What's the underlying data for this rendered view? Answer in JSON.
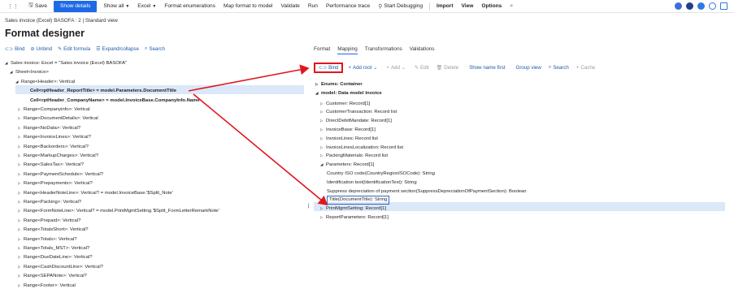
{
  "toolbar": {
    "save": "Save",
    "show_details": "Show details",
    "show_all": "Show all",
    "excel": "Excel",
    "format_enumerations": "Format enumerations",
    "map_format_to_model": "Map format to model",
    "validate": "Validate",
    "run": "Run",
    "performance_trace": "Performance trace",
    "start_debugging": "Start Debugging",
    "import": "Import",
    "view": "View",
    "options": "Options"
  },
  "breadcrumb": "Sales invoice (Excel) BASOFA : 2  |  Standard view",
  "page_title": "Format designer",
  "left_actions": {
    "bind": "Bind",
    "unbind": "Unbind",
    "edit_formula": "Edit formula",
    "expand_collapse": "Expand/collapse",
    "search": "Search"
  },
  "left_tree": [
    {
      "text": "Sales invoice: Excel = \"Sales invoice (Excel) BASOFA\"",
      "twist": "◢",
      "bold": false
    },
    {
      "text": "Sheet<Invoice>",
      "twist": "◢",
      "bold": false
    },
    {
      "text": "Range<Header>: Vertical",
      "twist": "◢",
      "bold": false
    },
    {
      "text": "Cell<rptHeader_ReportTitle> = model.Parameters.DocumentTitle",
      "twist": "",
      "bold": true
    },
    {
      "text": "Cell<rptHeader_CompanyName> = model.InvoiceBase.CompanyInfo.Name",
      "twist": "",
      "bold": true
    },
    {
      "text": "Range<Companyinfo>: Vertical",
      "twist": "▷",
      "bold": false
    },
    {
      "text": "Range<DocumentDetails>: Vertical",
      "twist": "▷",
      "bold": false
    },
    {
      "text": "Range<NoData>: Vertical?",
      "twist": "▷",
      "bold": false
    },
    {
      "text": "Range<InvoiceLines>: Vertical?",
      "twist": "▷",
      "bold": false
    },
    {
      "text": "Range<Backorders>: Vertical?",
      "twist": "▷",
      "bold": false
    },
    {
      "text": "Range<MarkupCharges>: Vertical?",
      "twist": "▷",
      "bold": false
    },
    {
      "text": "Range<SalesTax>: Vertical?",
      "twist": "▷",
      "bold": false
    },
    {
      "text": "Range<PaymentSchedule>: Vertical?",
      "twist": "▷",
      "bold": false
    },
    {
      "text": "Range<Prepayments>: Vertical?",
      "twist": "▷",
      "bold": false
    },
    {
      "text": "Range<HeaderNoteLine>: Vertical? = model.InvoiceBase.'$Split_Note'",
      "twist": "▷",
      "bold": false
    },
    {
      "text": "Range<Packing>: Vertical?",
      "twist": "▷",
      "bold": false
    },
    {
      "text": "Range<FormNoteLine>: Vertical? = model.PrintMgmtSetting.'$Split_FormLetterRemarkNote'",
      "twist": "▷",
      "bold": false
    },
    {
      "text": "Range<Prepaid>: Vertical?",
      "twist": "▷",
      "bold": false
    },
    {
      "text": "Range<TotalsShort>: Vertical?",
      "twist": "▷",
      "bold": false
    },
    {
      "text": "Range<Totals>: Vertical?",
      "twist": "▷",
      "bold": false
    },
    {
      "text": "Range<Totals_MST>: Vertical?",
      "twist": "▷",
      "bold": false
    },
    {
      "text": "Range<DueDateLine>: Vertical?",
      "twist": "▷",
      "bold": false
    },
    {
      "text": "Range<CashDiscountLine>: Vertical?",
      "twist": "▷",
      "bold": false
    },
    {
      "text": "Range<SEPANote>: Vertical?",
      "twist": "▷",
      "bold": false
    },
    {
      "text": "Range<Footer>: Vertical",
      "twist": "▷",
      "bold": false
    }
  ],
  "tabs": [
    "Format",
    "Mapping",
    "Transformations",
    "Validations"
  ],
  "right_actions": {
    "bind": "Bind",
    "add_root": "Add root",
    "add": "Add",
    "edit": "Edit",
    "delete": "Delete",
    "show_name_first": "Show name first",
    "group_view": "Group view",
    "search": "Search",
    "cache": "Cache"
  },
  "right_tree": [
    {
      "text": "Enums: Container",
      "twist": "▷",
      "bold": true
    },
    {
      "text": "model: Data model Invoice",
      "twist": "◢",
      "bold": true
    },
    {
      "text": "Customer: Record[1]",
      "twist": "▷",
      "bold": false
    },
    {
      "text": "CustomerTransaction: Record list",
      "twist": "▷",
      "bold": false
    },
    {
      "text": "DirectDebitMandate: Record[1]",
      "twist": "▷",
      "bold": false
    },
    {
      "text": "InvoiceBase: Record[1]",
      "twist": "▷",
      "bold": false
    },
    {
      "text": "InvoiceLines: Record list",
      "twist": "▷",
      "bold": false
    },
    {
      "text": "InvoiceLinesLocalization: Record list",
      "twist": "▷",
      "bold": false
    },
    {
      "text": "PackingMaterials: Record list",
      "twist": "▷",
      "bold": false
    },
    {
      "text": "Parameters: Record[1]",
      "twist": "◢",
      "bold": false
    },
    {
      "text": "Country ISO code(CountryRegionISOCode): String",
      "twist": "",
      "bold": false
    },
    {
      "text": "Identification text(IdentificationText): String",
      "twist": "",
      "bold": false
    },
    {
      "text": "Suppress depreciation of payment section(SuppressDepreciationOfPaymentSection): Boolean",
      "twist": "",
      "bold": false
    },
    {
      "text": "Title(DocumentTitle): String",
      "twist": "",
      "bold": false
    },
    {
      "text": "PrintMgmtSetting: Record[1]",
      "twist": "▷",
      "bold": false
    },
    {
      "text": "ReportParameters: Record[1]",
      "twist": "▷",
      "bold": false
    }
  ],
  "colors": {
    "accent": "#1e6ae6",
    "selection": "#dbe8f9",
    "annotation": "#e0161e"
  }
}
